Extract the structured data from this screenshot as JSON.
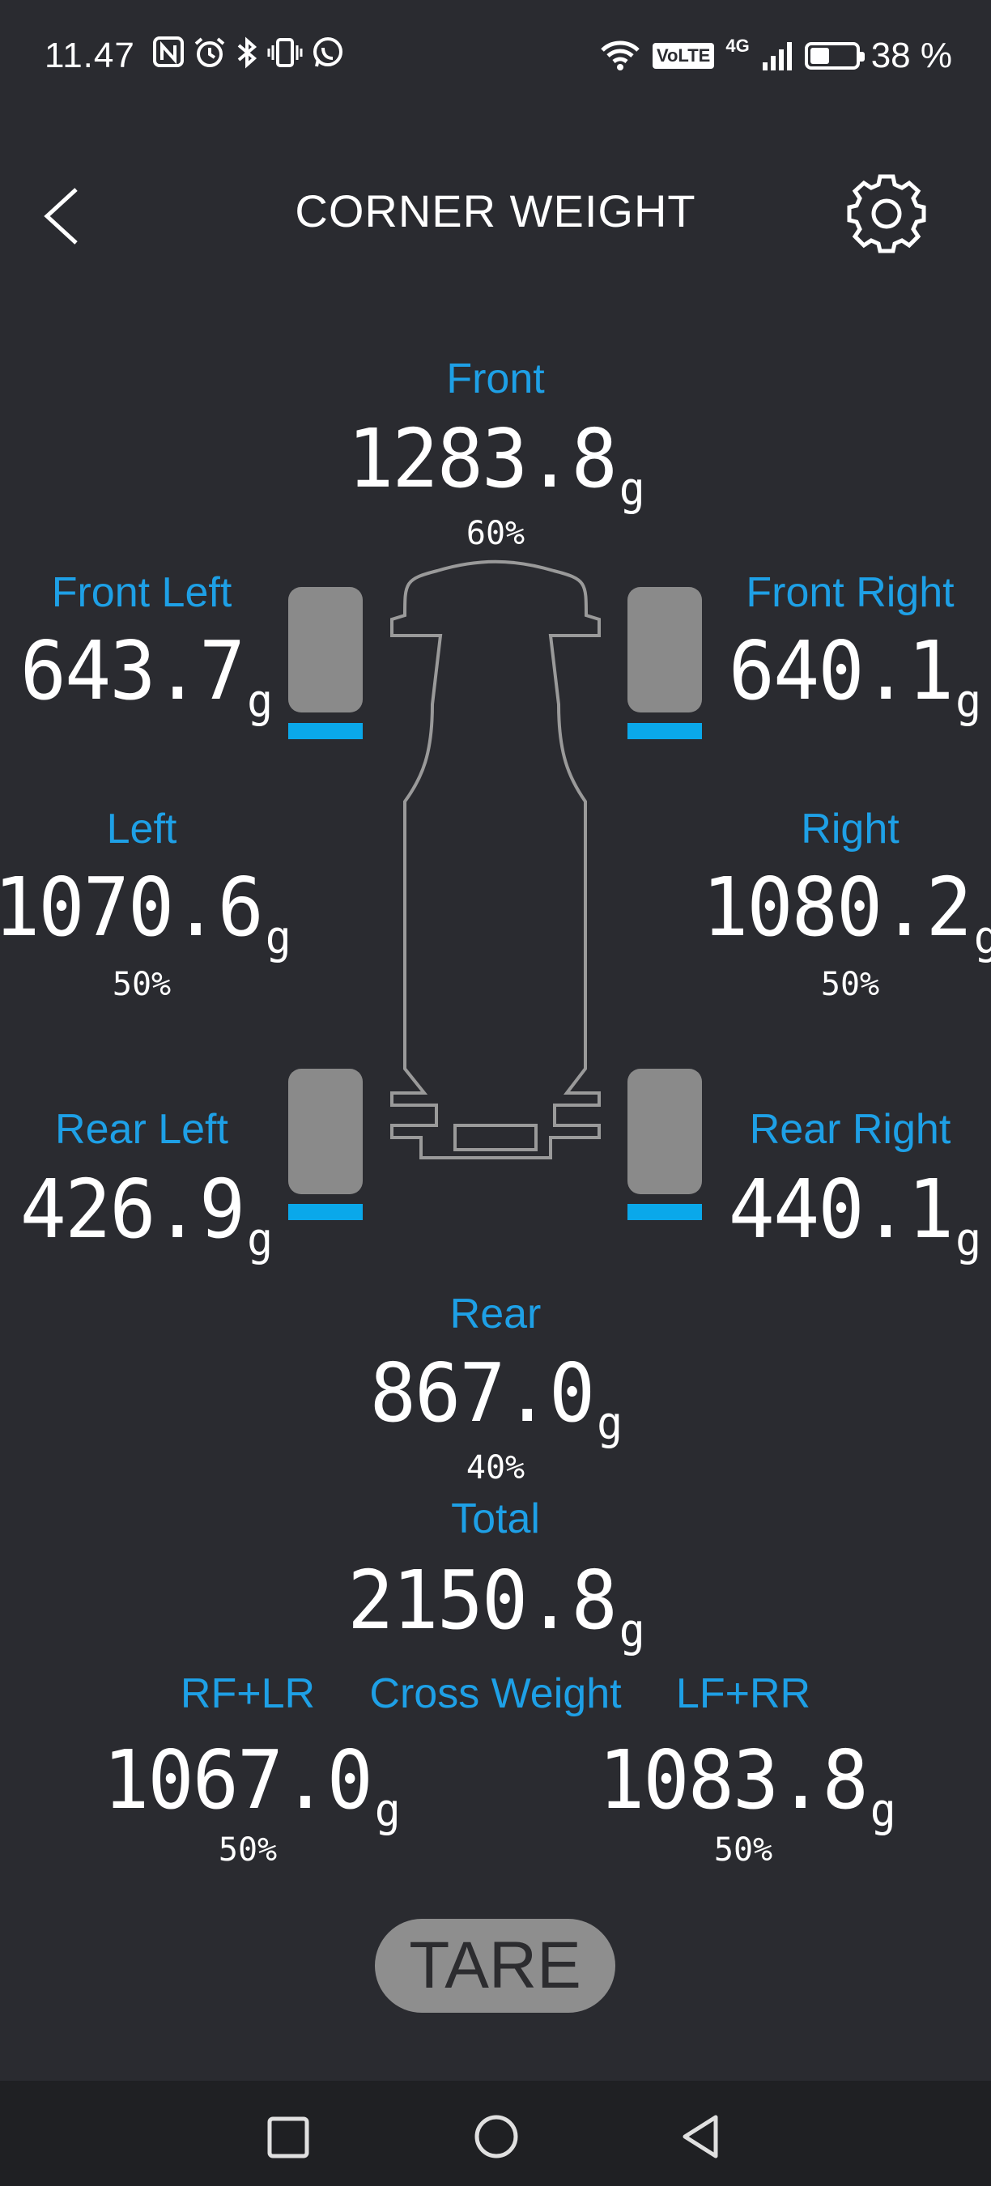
{
  "status_bar": {
    "time": "11.47",
    "network": "4G",
    "volte": "VoLTE",
    "battery_percent": "38 %",
    "battery_level": 0.38
  },
  "header": {
    "title": "CORNER WEIGHT"
  },
  "weights": {
    "front": {
      "label": "Front",
      "value": "1283.8",
      "unit": "g",
      "percent": "60%"
    },
    "front_left": {
      "label": "Front Left",
      "value": "643.7",
      "unit": "g"
    },
    "front_right": {
      "label": "Front Right",
      "value": "640.1",
      "unit": "g"
    },
    "left": {
      "label": "Left",
      "value": "1070.6",
      "unit": "g",
      "percent": "50%"
    },
    "right": {
      "label": "Right",
      "value": "1080.2",
      "unit": "g",
      "percent": "50%"
    },
    "rear_left": {
      "label": "Rear Left",
      "value": "426.9",
      "unit": "g"
    },
    "rear_right": {
      "label": "Rear Right",
      "value": "440.1",
      "unit": "g"
    },
    "rear": {
      "label": "Rear",
      "value": "867.0",
      "unit": "g",
      "percent": "40%"
    },
    "total": {
      "label": "Total",
      "value": "2150.8",
      "unit": "g"
    },
    "cross": {
      "label": "Cross Weight",
      "rf_lr": {
        "label": "RF+LR",
        "value": "1067.0",
        "unit": "g",
        "percent": "50%"
      },
      "lf_rr": {
        "label": "LF+RR",
        "value": "1083.8",
        "unit": "g",
        "percent": "50%"
      }
    }
  },
  "tare_button": {
    "label": "TARE"
  },
  "colors": {
    "background": "#2a2b30",
    "accent": "#1ea0e6",
    "wheel": "#8a8a8a",
    "wheel_indicator": "#0aa8ea"
  }
}
